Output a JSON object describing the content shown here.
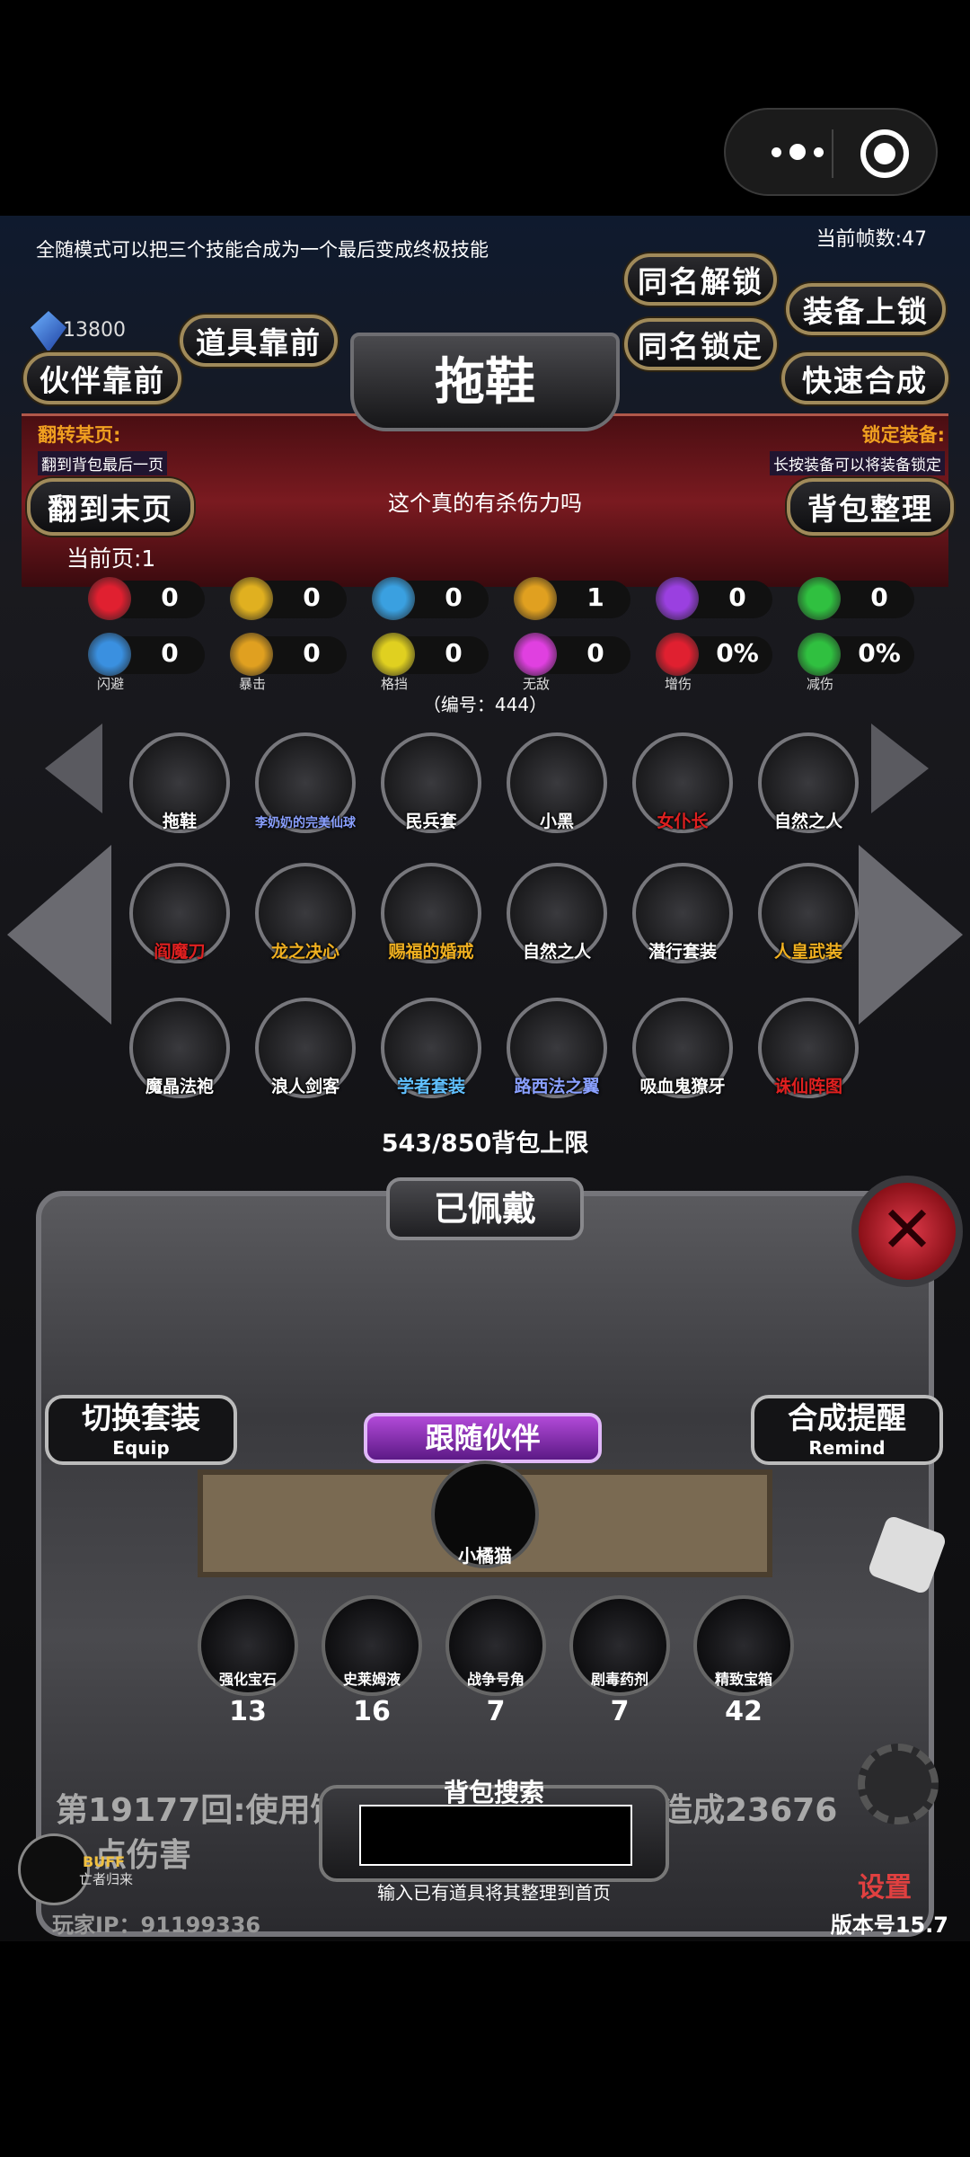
{
  "capsule": {
    "more_icon": "more-dots-icon",
    "close_icon": "target-circle-icon"
  },
  "header": {
    "tip": "全随模式可以把三个技能合成为一个最后变成终极技能",
    "fps": "当前帧数:47",
    "coins": "13800",
    "title": "拖鞋",
    "buttons": {
      "same_unlock": "同名解锁",
      "equip_unlock": "装备上锁",
      "items_front": "道具靠前",
      "same_lock": "同名锁定",
      "partner_front": "伙伴靠前",
      "quick_merge": "快速合成",
      "to_last_page": "翻到末页",
      "bag_sort": "背包整理"
    },
    "flip_label": "翻转某页:",
    "flip_sub": "翻到背包最后一页",
    "lock_label": "锁定装备:",
    "lock_sub": "长按装备可以将装备锁定",
    "question": "这个真的有杀伤力吗",
    "current_page": "当前页:1"
  },
  "stats": [
    {
      "icon": "heart-icon",
      "value": "0",
      "caption": "",
      "color": "#e02030"
    },
    {
      "icon": "armor-icon",
      "value": "0",
      "caption": "",
      "color": "#e0b020"
    },
    {
      "icon": "boot-icon",
      "value": "0",
      "caption": "",
      "color": "#3aa0e0"
    },
    {
      "icon": "sword-icon",
      "value": "1",
      "caption": "",
      "color": "#e0a020"
    },
    {
      "icon": "lightning-icon",
      "value": "0",
      "caption": "",
      "color": "#9a40e0"
    },
    {
      "icon": "clover-icon",
      "value": "0",
      "caption": "",
      "color": "#30c040"
    },
    {
      "icon": "dodge-icon",
      "value": "0",
      "caption": "闪避",
      "color": "#3a90e0"
    },
    {
      "icon": "crit-icon",
      "value": "0",
      "caption": "暴击",
      "color": "#e0a020"
    },
    {
      "icon": "shield-icon",
      "value": "0",
      "caption": "格挡",
      "color": "#e0d020"
    },
    {
      "icon": "wings-icon",
      "value": "0",
      "caption": "无敌",
      "color": "#e040e0"
    },
    {
      "icon": "swords-icon",
      "value": "0%",
      "caption": "增伤",
      "color": "#e02030"
    },
    {
      "icon": "green-shield-icon",
      "value": "0%",
      "caption": "减伤",
      "color": "#30c040"
    }
  ],
  "code": "（编号：444）",
  "items": [
    {
      "name": "拖鞋",
      "color": "#ffffff",
      "icon": "slipper-icon"
    },
    {
      "name": "李奶奶的完美仙球",
      "color": "#8aa0ff",
      "icon": "ball-icon"
    },
    {
      "name": "民兵套",
      "color": "#ffffff",
      "icon": "militia-icon"
    },
    {
      "name": "小黑",
      "color": "#ffffff",
      "icon": "fish-icon"
    },
    {
      "name": "女仆长",
      "color": "#e02020",
      "icon": "maid-icon"
    },
    {
      "name": "自然之人",
      "color": "#ffffff",
      "icon": "nature-man-icon"
    },
    {
      "name": "阎魔刀",
      "color": "#e02020",
      "icon": "blade-icon"
    },
    {
      "name": "龙之决心",
      "color": "#f0b020",
      "icon": "dragon-icon"
    },
    {
      "name": "赐福的婚戒",
      "color": "#f0b020",
      "icon": "ring-icon"
    },
    {
      "name": "自然之人",
      "color": "#ffffff",
      "icon": "nature-man-icon"
    },
    {
      "name": "潜行套装",
      "color": "#ffffff",
      "icon": "stealth-icon"
    },
    {
      "name": "人皇武装",
      "color": "#f0b020",
      "icon": "emperor-icon"
    },
    {
      "name": "魔晶法袍",
      "color": "#ffffff",
      "icon": "wizard-icon"
    },
    {
      "name": "浪人剑客",
      "color": "#ffffff",
      "icon": "ronin-icon"
    },
    {
      "name": "学者套装",
      "color": "#60c0ff",
      "icon": "scholar-icon"
    },
    {
      "name": "路西法之翼",
      "color": "#8aa0ff",
      "icon": "lucifer-wing-icon"
    },
    {
      "name": "吸血鬼獠牙",
      "color": "#ffffff",
      "icon": "fang-icon"
    },
    {
      "name": "诛仙阵图",
      "color": "#e02020",
      "icon": "formation-icon"
    }
  ],
  "capacity": "543/850背包上限",
  "equipped_label": "已佩戴",
  "switch_set": {
    "label": "切换套装",
    "sub": "Equip"
  },
  "merge_remind": {
    "label": "合成提醒",
    "sub": "Remind"
  },
  "follow_partner": "跟随伙伴",
  "pet_name": "小橘猫",
  "consumables": [
    {
      "name": "强化宝石",
      "qty": "13",
      "icon": "gem-icon"
    },
    {
      "name": "史莱姆液",
      "qty": "16",
      "icon": "potion-icon"
    },
    {
      "name": "战争号角",
      "qty": "7",
      "icon": "horn-icon"
    },
    {
      "name": "剧毒药剂",
      "qty": "7",
      "icon": "poison-icon"
    },
    {
      "name": "精致宝箱",
      "qty": "42",
      "icon": "chest-icon"
    }
  ],
  "log": {
    "line1a": "第19177回:使用饮",
    "line1b": "造成23676",
    "line2": "点伤害"
  },
  "search": {
    "label": "背包搜索",
    "value": "",
    "hint": "输入已有道具将其整理到首页"
  },
  "settings": "设置",
  "buff": {
    "title": "BUFF",
    "sub": "亡者归来"
  },
  "ip": "玩家IP：91199336",
  "version": "版本号15.7"
}
